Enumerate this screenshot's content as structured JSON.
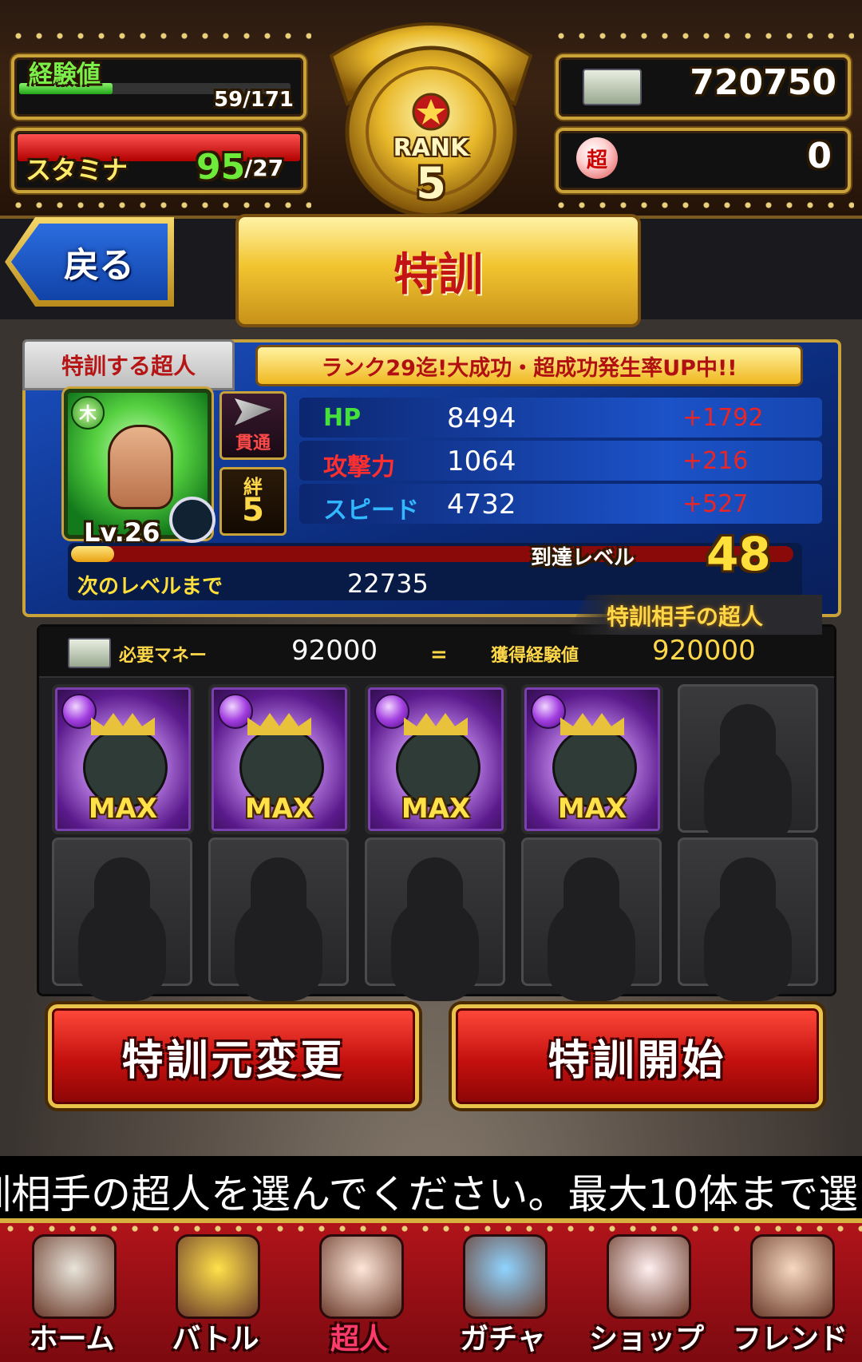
{
  "header": {
    "exp_label": "経験値",
    "exp_value": "59/171",
    "exp_fraction": 0.345,
    "stamina_label": "スタミナ",
    "stamina_current": "95",
    "stamina_max": "/27",
    "stamina_fraction": 1.0,
    "rank_label": "RANK",
    "rank_value": "5",
    "money": "720750",
    "super_currency": "0",
    "super_currency_icon_text": "超"
  },
  "nav_top": {
    "back_label": "戻る",
    "page_title": "特訓"
  },
  "training": {
    "tag_label": "特訓する超人",
    "campaign_text": "ランク29迄!大成功・超成功発生率UP中!!",
    "element_badge": "木",
    "skill_badge": "貫通",
    "bond_label": "絆",
    "bond_value": "5",
    "level_text": "Lv.26",
    "stats": [
      {
        "label": "HP",
        "value": "8494",
        "bonus": "+1792",
        "color": "#45e03a"
      },
      {
        "label": "攻撃力",
        "value": "1064",
        "bonus": "+216",
        "color": "#ff2f2f"
      },
      {
        "label": "スピード",
        "value": "4732",
        "bonus": "+527",
        "color": "#32b8ff"
      }
    ],
    "reach_level_label": "到達レベル",
    "reach_level_value": "48",
    "next_level_label": "次のレベルまで",
    "next_level_value": "22735",
    "exp_progress_fraction": 0.06
  },
  "partner": {
    "tag_label": "特訓相手の超人",
    "money_label": "必要マネー",
    "money_value": "92000",
    "exp_label": "獲得経験値",
    "exp_value": "920000",
    "slots": [
      {
        "filled": true,
        "badge": "MAX"
      },
      {
        "filled": true,
        "badge": "MAX"
      },
      {
        "filled": true,
        "badge": "MAX"
      },
      {
        "filled": true,
        "badge": "MAX"
      },
      {
        "filled": false,
        "badge": ""
      },
      {
        "filled": false,
        "badge": ""
      },
      {
        "filled": false,
        "badge": ""
      },
      {
        "filled": false,
        "badge": ""
      },
      {
        "filled": false,
        "badge": ""
      },
      {
        "filled": false,
        "badge": ""
      }
    ]
  },
  "actions": {
    "change_label": "特訓元変更",
    "start_label": "特訓開始"
  },
  "ticker": {
    "text": "訓相手の超人を選んでください。最大10体まで選"
  },
  "bottom_nav": {
    "items": [
      {
        "label": "ホーム",
        "icon": "home-icon",
        "active": false
      },
      {
        "label": "バトル",
        "icon": "battle-icon",
        "active": false
      },
      {
        "label": "超人",
        "icon": "chojin-icon",
        "active": true
      },
      {
        "label": "ガチャ",
        "icon": "gacha-icon",
        "active": false
      },
      {
        "label": "ショップ",
        "icon": "shop-icon",
        "active": false
      },
      {
        "label": "フレンド",
        "icon": "friend-icon",
        "active": false
      }
    ]
  }
}
